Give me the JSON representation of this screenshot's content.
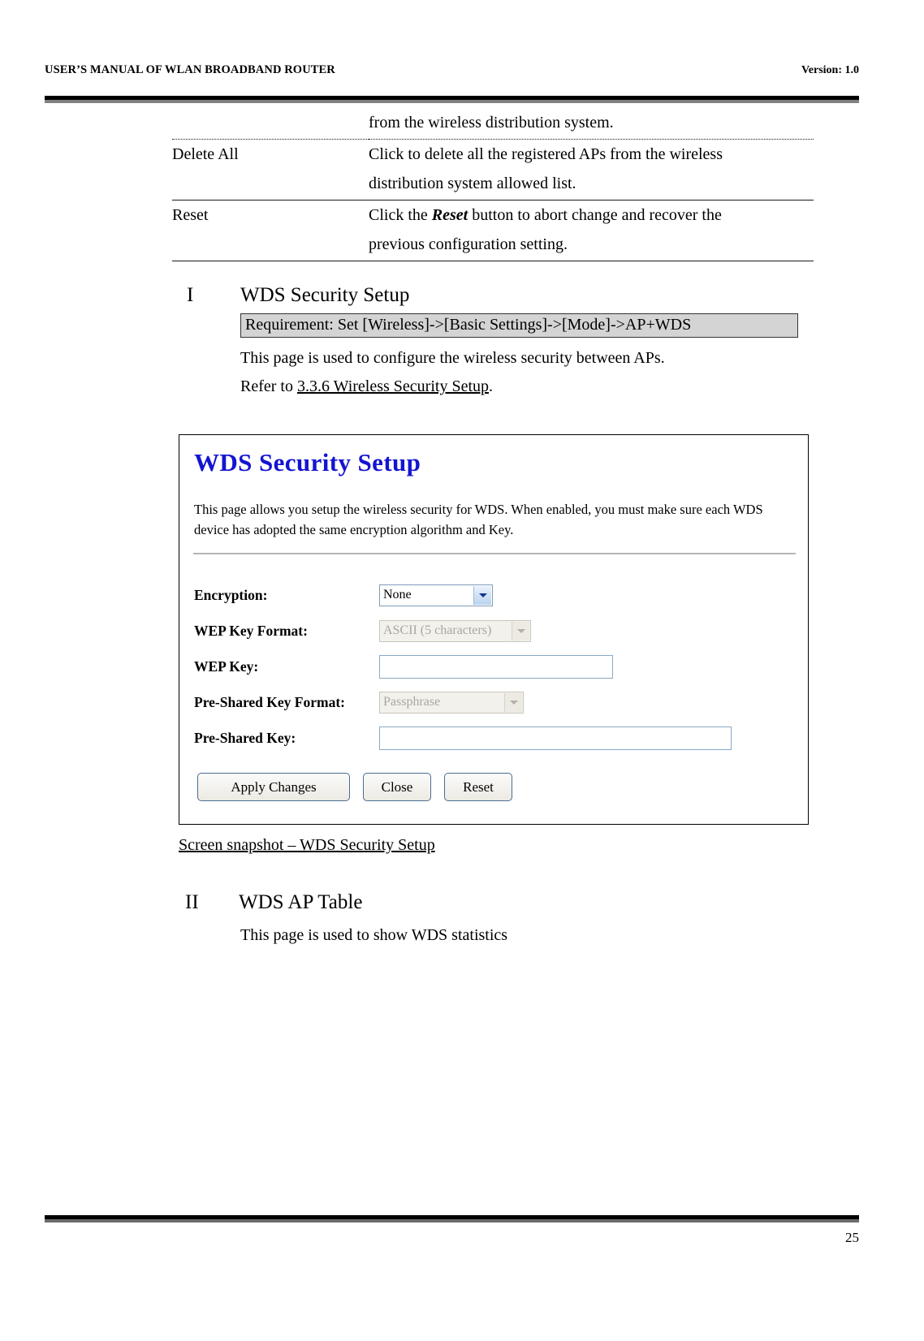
{
  "header": {
    "left_title": "USER’S MANUAL OF WLAN BROADBAND ROUTER",
    "version": "Version: 1.0"
  },
  "footer": {
    "page_number": "25"
  },
  "definition_table": {
    "rows": [
      {
        "term": "",
        "desc": "from the wireless distribution system."
      },
      {
        "term": "Delete All",
        "desc_line1": "Click to delete all the registered APs from the wireless",
        "desc_line2": "distribution system allowed list."
      },
      {
        "term": "Reset",
        "desc_line1_pre": "Click the ",
        "desc_line1_em": "Reset",
        "desc_line1_post": " button to abort change and recover the",
        "desc_line2": "previous configuration setting."
      }
    ]
  },
  "section_one": {
    "number": "I",
    "title": "WDS Security Setup",
    "requirement": "Requirement: Set [Wireless]->[Basic Settings]->[Mode]->AP+WDS",
    "body_line_1": "This page is used to configure the wireless security between APs.",
    "body_line_2_pre": "Refer to ",
    "body_line_2_link": "3.3.6 Wireless Security Setup",
    "body_line_2_post": "."
  },
  "screenshot": {
    "title": "WDS Security Setup",
    "title_color": "#1414d2",
    "description": "This page allows you setup the wireless security for WDS. When enabled, you must make sure each WDS device has adopted the same encryption algorithm and Key.",
    "fields": [
      {
        "label": "Encryption:",
        "type": "select",
        "value": "None",
        "state": "enabled"
      },
      {
        "label": "WEP Key Format:",
        "type": "select",
        "value": "ASCII (5 characters)",
        "state": "disabled"
      },
      {
        "label": "WEP Key:",
        "type": "text",
        "value": "",
        "state": "enabled"
      },
      {
        "label": "Pre-Shared Key Format:",
        "type": "select",
        "value": "Passphrase",
        "state": "disabled"
      },
      {
        "label": "Pre-Shared Key:",
        "type": "text",
        "value": "",
        "state": "enabled"
      }
    ],
    "buttons": {
      "apply": "Apply Changes",
      "close": "Close",
      "reset": "Reset"
    }
  },
  "caption": "Screen snapshot – WDS Security Setup",
  "section_two": {
    "number": "II",
    "title": "WDS AP Table",
    "body_line_1": "This page is used to show WDS statistics"
  }
}
